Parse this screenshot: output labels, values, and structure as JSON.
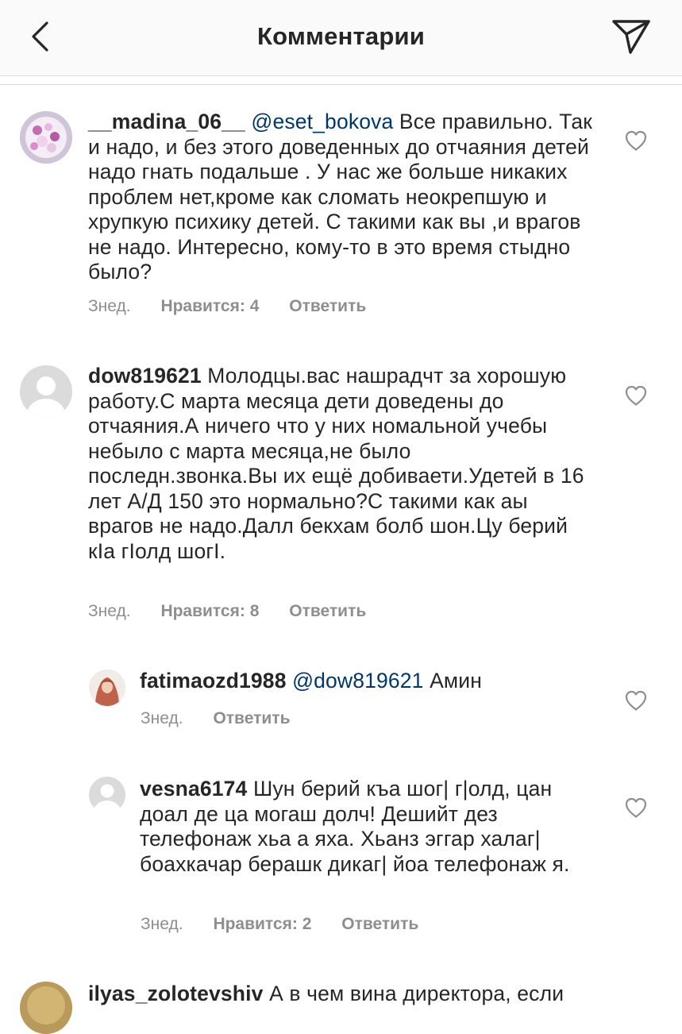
{
  "header": {
    "title": "Комментарии"
  },
  "comments": [
    {
      "username": "__madina_06__",
      "mention": "@eset_bokova",
      "text": "Все правильно. Так и надо, и без этого  доведенных  до отчаяния детей надо гнать подальше .  У нас же больше никаких проблем нет,кроме как сломать неокрепшую  и хрупкую психику детей. С такими как вы ,и врагов не надо. Интересно, кому-то в это время стыдно было?",
      "time": "Знед.",
      "likes": "Нравится: 4",
      "reply": "Ответить"
    },
    {
      "username": "dow819621",
      "mention": "",
      "text": "Молодцы.вас нашрадчт за хорошую работу.С марта месяца дети доведены до отчаяния.А  ничего что у них номальной учебы небыло с марта  месяца,не было последн.звонка.Вы их ещё добиваети.Удетей в 16 лет А/Д 150 это нормально?С такими как аы врагов  не надо.Далл бекхам болб шон.Цу берий кIа гIолд шогI.",
      "time": "Знед.",
      "likes": "Нравится: 8",
      "reply": "Ответить"
    },
    {
      "username": "fatimaozd1988",
      "mention": "@dow819621",
      "text": "Амин",
      "time": "Знед.",
      "likes": "",
      "reply": "Ответить"
    },
    {
      "username": "vesna6174",
      "mention": "",
      "text": "Шун берий къа шог| г|олд, цан доал де ца могаш долч! Дешийт дез телефонаж хьа а яха. Хьанз эггар халаг| боахкачар берашк дикаг| йоа телефонаж я.",
      "time": "Знед.",
      "likes": "Нравится: 2",
      "reply": "Ответить"
    },
    {
      "username": "ilyas_zolotevshiv",
      "mention": "",
      "text": "А в чем вина директора, если",
      "time": "",
      "likes": "",
      "reply": ""
    }
  ],
  "icons": {
    "back": "chevron-left-icon",
    "share": "paper-plane-icon",
    "like": "heart-outline-icon"
  },
  "colors": {
    "text": "#262626",
    "mention": "#00376b",
    "meta": "#8e8e8e",
    "header_bg": "#fafafa",
    "border": "#dbdbdb"
  }
}
